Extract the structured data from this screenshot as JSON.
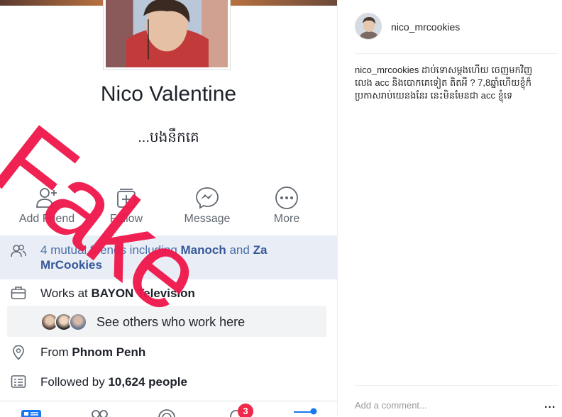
{
  "facebook": {
    "profile_name": "Nico Valentine",
    "bio": "...បងនឹកគេ",
    "actions": [
      {
        "label": "Add Friend",
        "icon": "add-friend-icon"
      },
      {
        "label": "Follow",
        "icon": "follow-icon"
      },
      {
        "label": "Message",
        "icon": "messenger-icon"
      },
      {
        "label": "More",
        "icon": "more-icon"
      }
    ],
    "mutual": {
      "prefix": "4 mutual friends including ",
      "name1": "Manoch",
      "joiner": " and ",
      "name2": "Za MrCookies"
    },
    "work": {
      "prefix": "Works at ",
      "value": "BAYON Television"
    },
    "see_others": "See others who work here",
    "from": {
      "prefix": "From ",
      "value": "Phnom Penh"
    },
    "followed": {
      "prefix": "Followed by ",
      "value": "10,624 people"
    },
    "bottom_nav": {
      "notifications_badge": "3"
    },
    "overlay_text": "Fake",
    "colors": {
      "overlay": "#f0174b",
      "link": "#365899",
      "mutual_bg": "#e9eef6"
    }
  },
  "instagram": {
    "username": "nico_mrcookies",
    "caption_user": "nico_mrcookies",
    "caption_text": " ដាប់ទោសម្ដងហើយ ចេញមកវិញលេង acc និងបោកគេទៀត តិតអី ? 7,8ឆ្នាំហើយខ្ញុំក៏ប្រកាសរាប់យេនងនែរ នេះមិនមែនជា acc ខ្ញុំទេ",
    "comment_placeholder": "Add a comment...",
    "more_label": "..."
  }
}
